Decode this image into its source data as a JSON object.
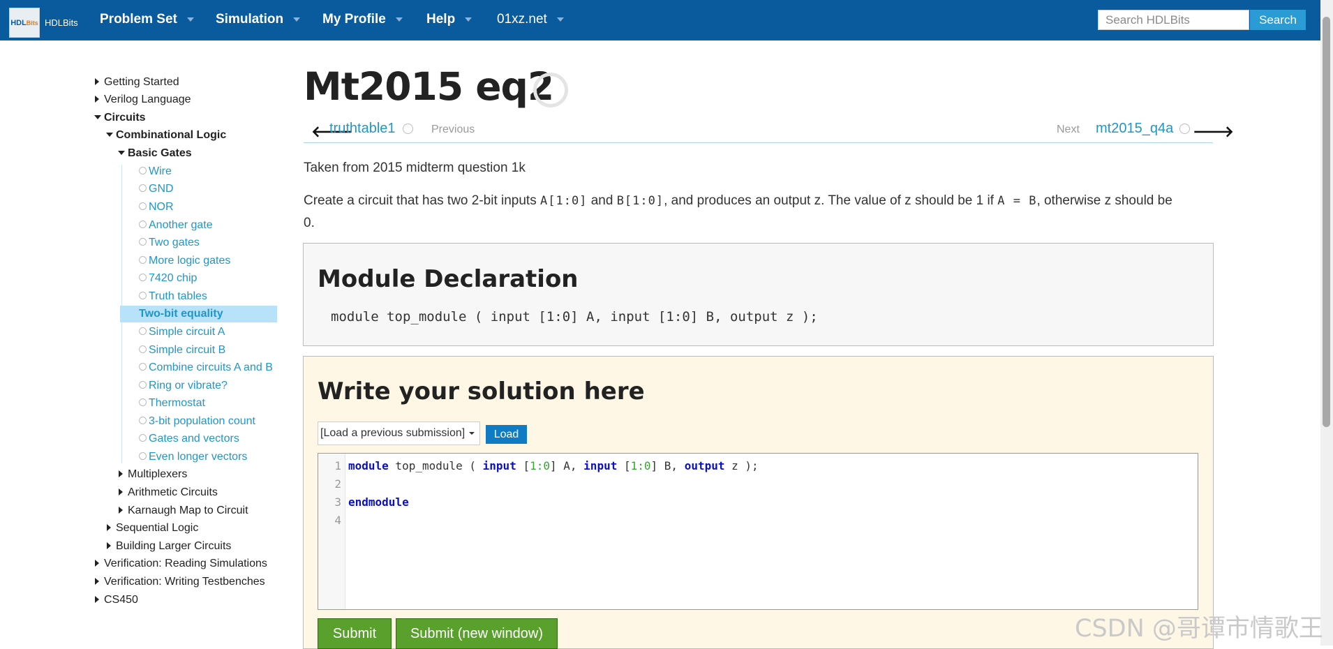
{
  "nav": {
    "logo_label": "HDLBits",
    "logo_mark": "HDL",
    "logo_mark_suffix": "Bits",
    "items": [
      {
        "label": "Problem Set"
      },
      {
        "label": "Simulation"
      },
      {
        "label": "My Profile"
      },
      {
        "label": "Help"
      },
      {
        "label": "01xz.net"
      }
    ],
    "search_placeholder": "Search HDLBits",
    "search_button": "Search"
  },
  "sidebar": {
    "top": [
      {
        "label": "Getting Started"
      },
      {
        "label": "Verilog Language"
      },
      {
        "label": "Circuits"
      }
    ],
    "combinational": "Combinational Logic",
    "basic_gates": "Basic Gates",
    "leaves": [
      {
        "label": "Wire"
      },
      {
        "label": "GND"
      },
      {
        "label": "NOR"
      },
      {
        "label": "Another gate"
      },
      {
        "label": "Two gates"
      },
      {
        "label": "More logic gates"
      },
      {
        "label": "7420 chip"
      },
      {
        "label": "Truth tables"
      },
      {
        "label": "Two-bit equality"
      },
      {
        "label": "Simple circuit A"
      },
      {
        "label": "Simple circuit B"
      },
      {
        "label": "Combine circuits A and B"
      },
      {
        "label": "Ring or vibrate?"
      },
      {
        "label": "Thermostat"
      },
      {
        "label": "3-bit population count"
      },
      {
        "label": "Gates and vectors"
      },
      {
        "label": "Even longer vectors"
      }
    ],
    "sub_sections": [
      {
        "label": "Multiplexers"
      },
      {
        "label": "Arithmetic Circuits"
      },
      {
        "label": "Karnaugh Map to Circuit"
      }
    ],
    "sections": [
      {
        "label": "Sequential Logic"
      },
      {
        "label": "Building Larger Circuits"
      }
    ],
    "bottom": [
      {
        "label": "Verification: Reading Simulations"
      },
      {
        "label": "Verification: Writing Testbenches"
      },
      {
        "label": "CS450"
      }
    ]
  },
  "page": {
    "title": "Mt2015 eq2",
    "prev_link": "truthtable1",
    "prev_label": "Previous",
    "next_label": "Next",
    "next_link": "mt2015_q4a",
    "intro": "Taken from 2015 midterm question 1k",
    "desc_1": "Create a circuit that has two 2-bit inputs ",
    "desc_a": "A[1:0]",
    "desc_2": " and ",
    "desc_b": "B[1:0]",
    "desc_3": ", and produces an output z. The value of z should be 1 if ",
    "desc_eq": "A = B",
    "desc_4": ", otherwise z should be",
    "desc_5": "0."
  },
  "declaration": {
    "title": "Module Declaration",
    "code": "module top_module ( input [1:0] A, input [1:0] B, output z );"
  },
  "solution": {
    "title": "Write your solution here",
    "select_value": "[Load a previous submission]",
    "load_button": "Load",
    "line_numbers": [
      "1",
      "2",
      "3",
      "4"
    ],
    "code": {
      "kw_module": "module",
      "name": " top_module ( ",
      "kw_input1": "input",
      "r1_open": " [",
      "r1_n": "1:0",
      "r1_close": "] A, ",
      "kw_input2": "input",
      "r2_open": " [",
      "r2_n": "1:0",
      "r2_close": "] B, ",
      "kw_output": "output",
      "tail": " z );",
      "kw_end": "endmodule"
    },
    "submit": "Submit",
    "submit_new": "Submit (new window)"
  },
  "watermark": "CSDN @哥谭市情歌王"
}
